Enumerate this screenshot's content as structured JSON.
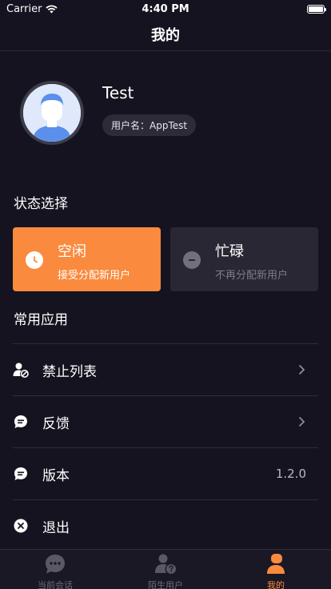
{
  "status_bar": {
    "carrier": "Carrier",
    "time": "4:40 PM"
  },
  "nav": {
    "title": "我的"
  },
  "profile": {
    "name": "Test",
    "account_label": "用户名：AppTest"
  },
  "status_section": {
    "title": "状态选择",
    "options": [
      {
        "title": "空闲",
        "subtitle": "接受分配新用户",
        "icon": "clock-icon",
        "selected": true
      },
      {
        "title": "忙碌",
        "subtitle": "不再分配新用户",
        "icon": "minus-circle-icon",
        "selected": false
      }
    ]
  },
  "apps_section": {
    "title": "常用应用",
    "items": [
      {
        "label": "禁止列表",
        "icon": "user-block-icon",
        "value": ""
      },
      {
        "label": "反馈",
        "icon": "chat-bubble-icon",
        "value": ""
      },
      {
        "label": "版本",
        "icon": "chat-bubble-icon",
        "value": "1.2.0"
      },
      {
        "label": "退出",
        "icon": "close-circle-icon",
        "value": ""
      }
    ]
  },
  "tab_bar": {
    "tabs": [
      {
        "label": "当前会话",
        "icon": "chat-icon",
        "active": false
      },
      {
        "label": "陌生用户",
        "icon": "unknown-user-icon",
        "active": false
      },
      {
        "label": "我的",
        "icon": "profile-icon",
        "active": true
      }
    ]
  },
  "colors": {
    "background": "#15131f",
    "accent": "#fa8a3d",
    "card_inactive": "#292734",
    "divider": "#2e2c3a"
  }
}
